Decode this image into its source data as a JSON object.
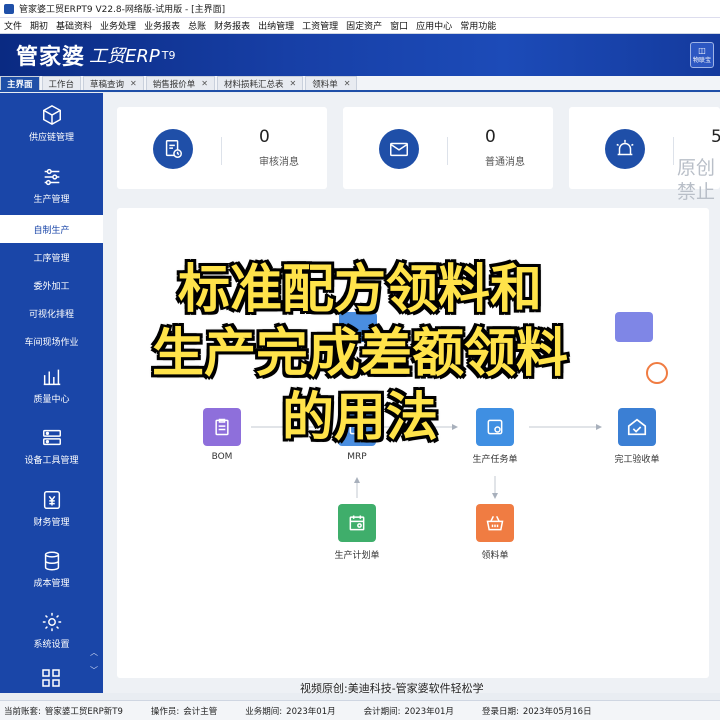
{
  "app": {
    "title": "管家婆工贸ERPT9 V22.8-网络版-试用版 - [主界面]"
  },
  "menu": [
    "文件",
    "期初",
    "基础资料",
    "业务处理",
    "业务报表",
    "总账",
    "财务报表",
    "出纳管理",
    "工资管理",
    "固定资产",
    "窗口",
    "应用中心",
    "常用功能"
  ],
  "banner": {
    "brand": "管家婆",
    "product": "工贸ERP",
    "version": "T9",
    "iot_label": "物联宝"
  },
  "tabs": [
    {
      "label": "主界面",
      "active": true,
      "closable": false
    },
    {
      "label": "工作台",
      "active": false,
      "closable": false
    },
    {
      "label": "草稿查询",
      "active": false,
      "closable": true
    },
    {
      "label": "销售报价单",
      "active": false,
      "closable": true
    },
    {
      "label": "材料损耗汇总表",
      "active": false,
      "closable": true
    },
    {
      "label": "领料单",
      "active": false,
      "closable": true
    }
  ],
  "sidebar": {
    "top": {
      "label": "供应链管理",
      "icon": "cube-icon"
    },
    "main": {
      "label": "生产管理",
      "icon": "sliders-icon"
    },
    "sub": [
      "自制生产",
      "工序管理",
      "委外加工",
      "可视化排程",
      "车间现场作业"
    ],
    "rest": [
      {
        "label": "质量中心",
        "icon": "chart-icon"
      },
      {
        "label": "设备工具管理",
        "icon": "equipment-icon"
      },
      {
        "label": "财务管理",
        "icon": "finance-icon"
      },
      {
        "label": "成本管理",
        "icon": "database-icon"
      },
      {
        "label": "系统设置",
        "icon": "gear-icon"
      }
    ]
  },
  "cards": [
    {
      "count": "0",
      "label": "审核消息",
      "icon": "audit-icon"
    },
    {
      "count": "0",
      "label": "普通消息",
      "icon": "mail-icon"
    },
    {
      "count": "5",
      "label": "",
      "icon": "alarm-icon"
    }
  ],
  "watermark": [
    "原创",
    "禁止"
  ],
  "flow": {
    "nodes": [
      {
        "id": "bom",
        "label": "BOM",
        "color": "#8e6fdb"
      },
      {
        "id": "mrp",
        "label": "MRP",
        "color": "#4a8ee0"
      },
      {
        "id": "task",
        "label": "生产任务单",
        "color": "#3f8fe2"
      },
      {
        "id": "finish",
        "label": "完工验收单",
        "color": "#3b7fd4"
      },
      {
        "id": "plan",
        "label": "生产计划单",
        "color": "#3fae6b"
      },
      {
        "id": "pick",
        "label": "领料单",
        "color": "#f07c42"
      }
    ]
  },
  "overlay": [
    "标准配方领料和",
    "生产完成差额领料",
    "的用法"
  ],
  "caption": "视频原创:美迪科技-管家婆软件轻松学",
  "status": [
    {
      "label": "当前账套:",
      "value": "管家婆工贸ERP新T9"
    },
    {
      "label": "操作员:",
      "value": "会计主管"
    },
    {
      "label": "业务期间:",
      "value": "2023年01月"
    },
    {
      "label": "会计期间:",
      "value": "2023年01月"
    },
    {
      "label": "登录日期:",
      "value": "2023年05月16日"
    }
  ]
}
